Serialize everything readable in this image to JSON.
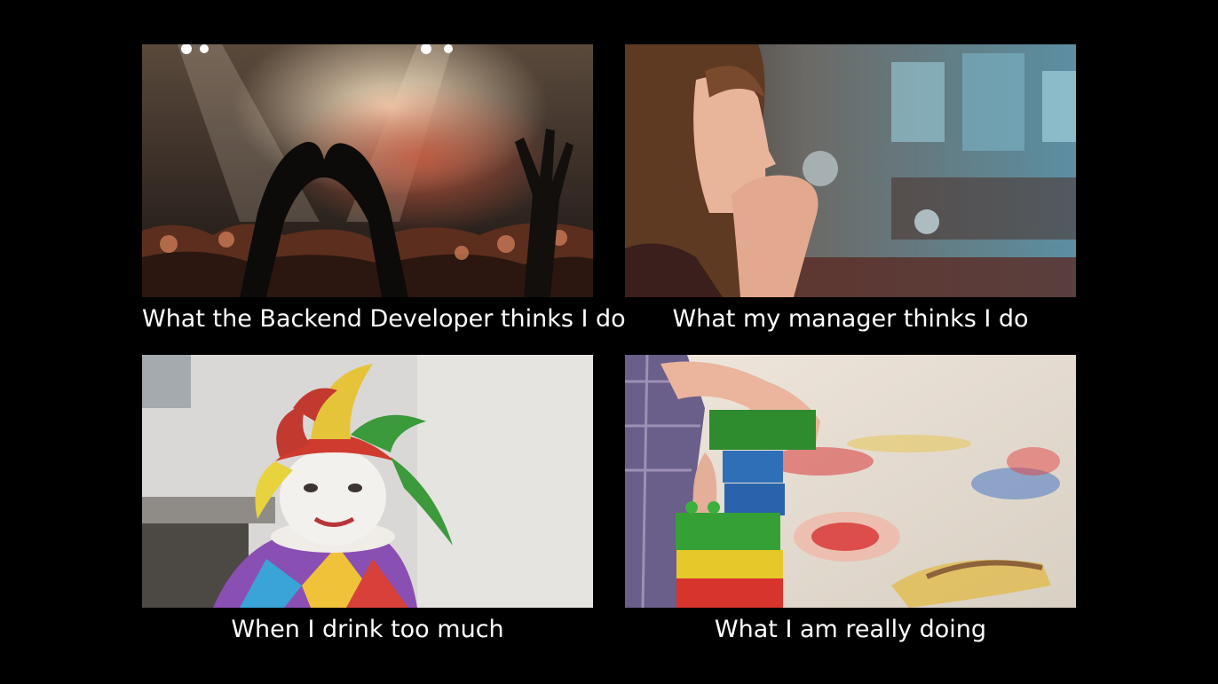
{
  "panels": [
    {
      "caption": "What the Backend Developer thinks I do",
      "image": "concert-crowd-heart-hands"
    },
    {
      "caption": "What my manager thinks I do",
      "image": "woman-praying-thinking"
    },
    {
      "caption": "When I drink too much",
      "image": "smiling-jester-clown"
    },
    {
      "caption": "What I am really doing",
      "image": "child-stacking-toy-blocks"
    }
  ],
  "colors": {
    "background": "#000000",
    "caption_text": "#ffffff"
  }
}
